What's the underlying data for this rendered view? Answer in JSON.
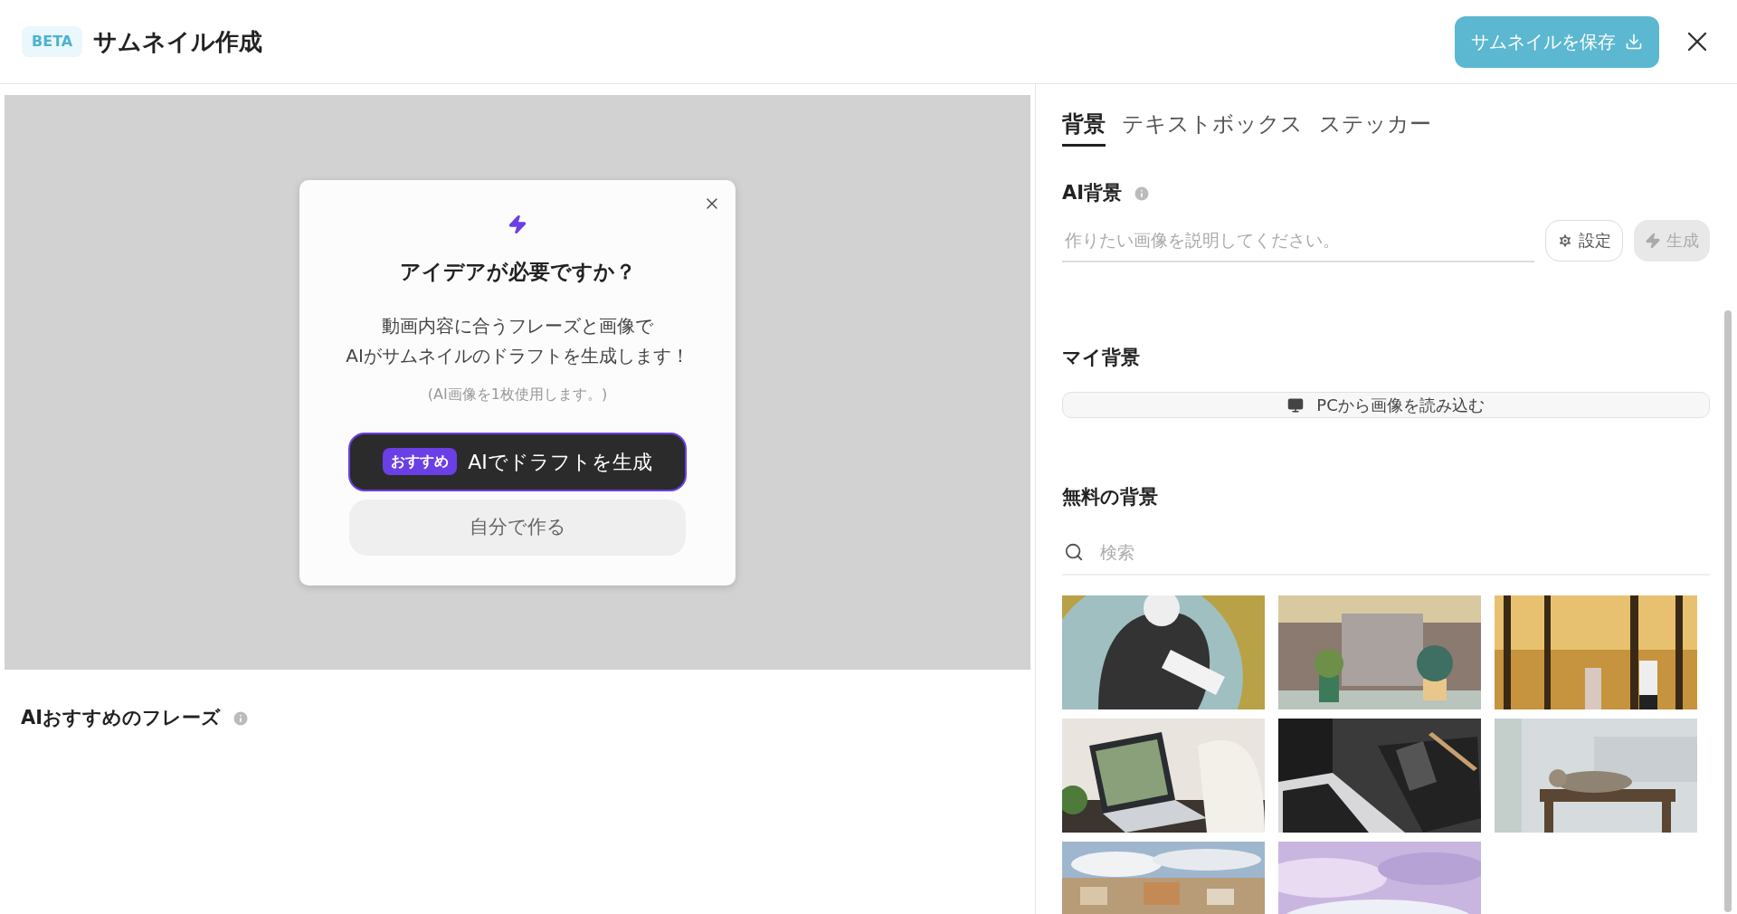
{
  "header": {
    "badge": "BETA",
    "title": "サムネイル作成",
    "save_button": "サムネイルを保存"
  },
  "modal": {
    "title": "アイデアが必要ですか？",
    "description": "動画内容に合うフレーズと画像で\nAIがサムネイルのドラフトを生成します！",
    "note": "(AI画像を1枚使用します。)",
    "primary_badge": "おすすめ",
    "primary_button": "AIでドラフトを生成",
    "secondary_button": "自分で作る"
  },
  "phrases_heading": "AIおすすめのフレーズ",
  "tabs": [
    {
      "label": "背景",
      "selected": true
    },
    {
      "label": "テキストボックス",
      "selected": false
    },
    {
      "label": "ステッカー",
      "selected": false
    }
  ],
  "ai_background": {
    "heading": "AI背景",
    "placeholder": "作りたい画像を説明してください。",
    "settings_button": "設定",
    "generate_button": "生成",
    "generate_disabled": true
  },
  "my_background": {
    "heading": "マイ背景",
    "upload_button": "PCから画像を読み込む"
  },
  "free_backgrounds": {
    "heading": "無料の背景",
    "search_placeholder": "検索"
  }
}
